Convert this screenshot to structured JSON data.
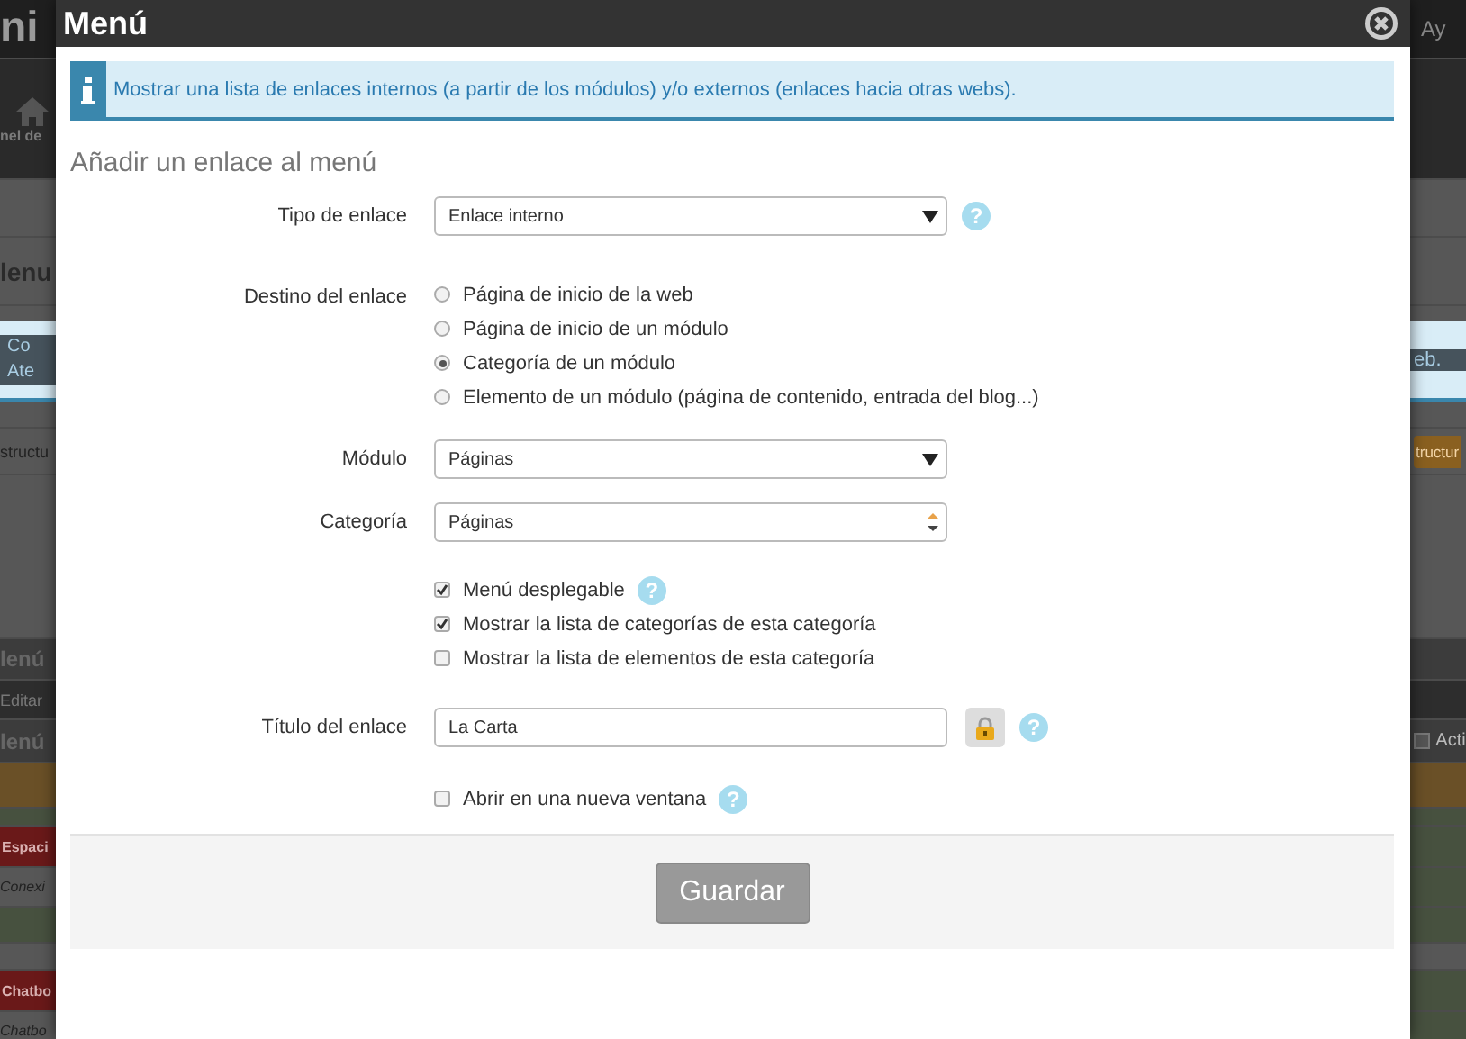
{
  "background": {
    "rows": [
      {
        "kind": "header",
        "left": "ni",
        "right": "Ay"
      },
      {
        "kind": "nav",
        "left": "nel de"
      },
      {
        "kind": "plain"
      },
      {
        "kind": "title",
        "left": "lenu"
      },
      {
        "kind": "info",
        "left_lines": [
          "Co",
          "Ate"
        ],
        "right": "eb."
      },
      {
        "kind": "gap"
      },
      {
        "kind": "toolbar",
        "left": "structu",
        "right": "tructur"
      },
      {
        "kind": "space"
      },
      {
        "kind": "section",
        "left": "lenú"
      },
      {
        "kind": "edit",
        "left": "Editar"
      },
      {
        "kind": "section-check",
        "left": "lenú",
        "right": "Acti",
        "checked": false
      },
      {
        "kind": "orange"
      },
      {
        "kind": "green"
      },
      {
        "kind": "red-heading",
        "left": "Espaci"
      },
      {
        "kind": "italic",
        "left": "Conexi"
      },
      {
        "kind": "green-end"
      },
      {
        "kind": "gap"
      },
      {
        "kind": "red-heading",
        "left": "Chatbo"
      },
      {
        "kind": "italic",
        "left": "Chatbo"
      }
    ]
  },
  "dialog": {
    "title": "Menú",
    "info": "Mostrar una lista de enlaces internos (a partir de los módulos) y/o externos (enlaces hacia otras webs).",
    "heading": "Añadir un enlace al menú",
    "fields": [
      {
        "kind": "select",
        "label": "Tipo de enlace",
        "value": "Enlace interno",
        "help": "?"
      },
      {
        "kind": "radio",
        "label": "Destino del enlace",
        "options": [
          {
            "label": "Página de inicio de la web",
            "selected": false
          },
          {
            "label": "Página de inicio de un módulo",
            "selected": false
          },
          {
            "label": "Categoría de un módulo",
            "selected": true
          },
          {
            "label": "Elemento de un módulo (página de contenido, entrada del blog...)",
            "selected": false
          }
        ]
      },
      {
        "kind": "select",
        "label": "Módulo",
        "value": "Páginas"
      },
      {
        "kind": "combo",
        "label": "Categoría",
        "value": "Páginas"
      },
      {
        "kind": "checks",
        "options": [
          {
            "label": "Menú desplegable",
            "checked": true,
            "help": "?"
          },
          {
            "label": "Mostrar la lista de categorías de esta categoría",
            "checked": true
          },
          {
            "label": "Mostrar la lista de elementos de esta categoría",
            "checked": false
          }
        ]
      },
      {
        "kind": "text",
        "label": "Título del enlace",
        "value": "La Carta",
        "lock": true,
        "help": "?"
      },
      {
        "kind": "checks",
        "options": [
          {
            "label": "Abrir en una nueva ventana",
            "checked": false,
            "help": "?"
          }
        ]
      }
    ],
    "button": "Guardar"
  }
}
